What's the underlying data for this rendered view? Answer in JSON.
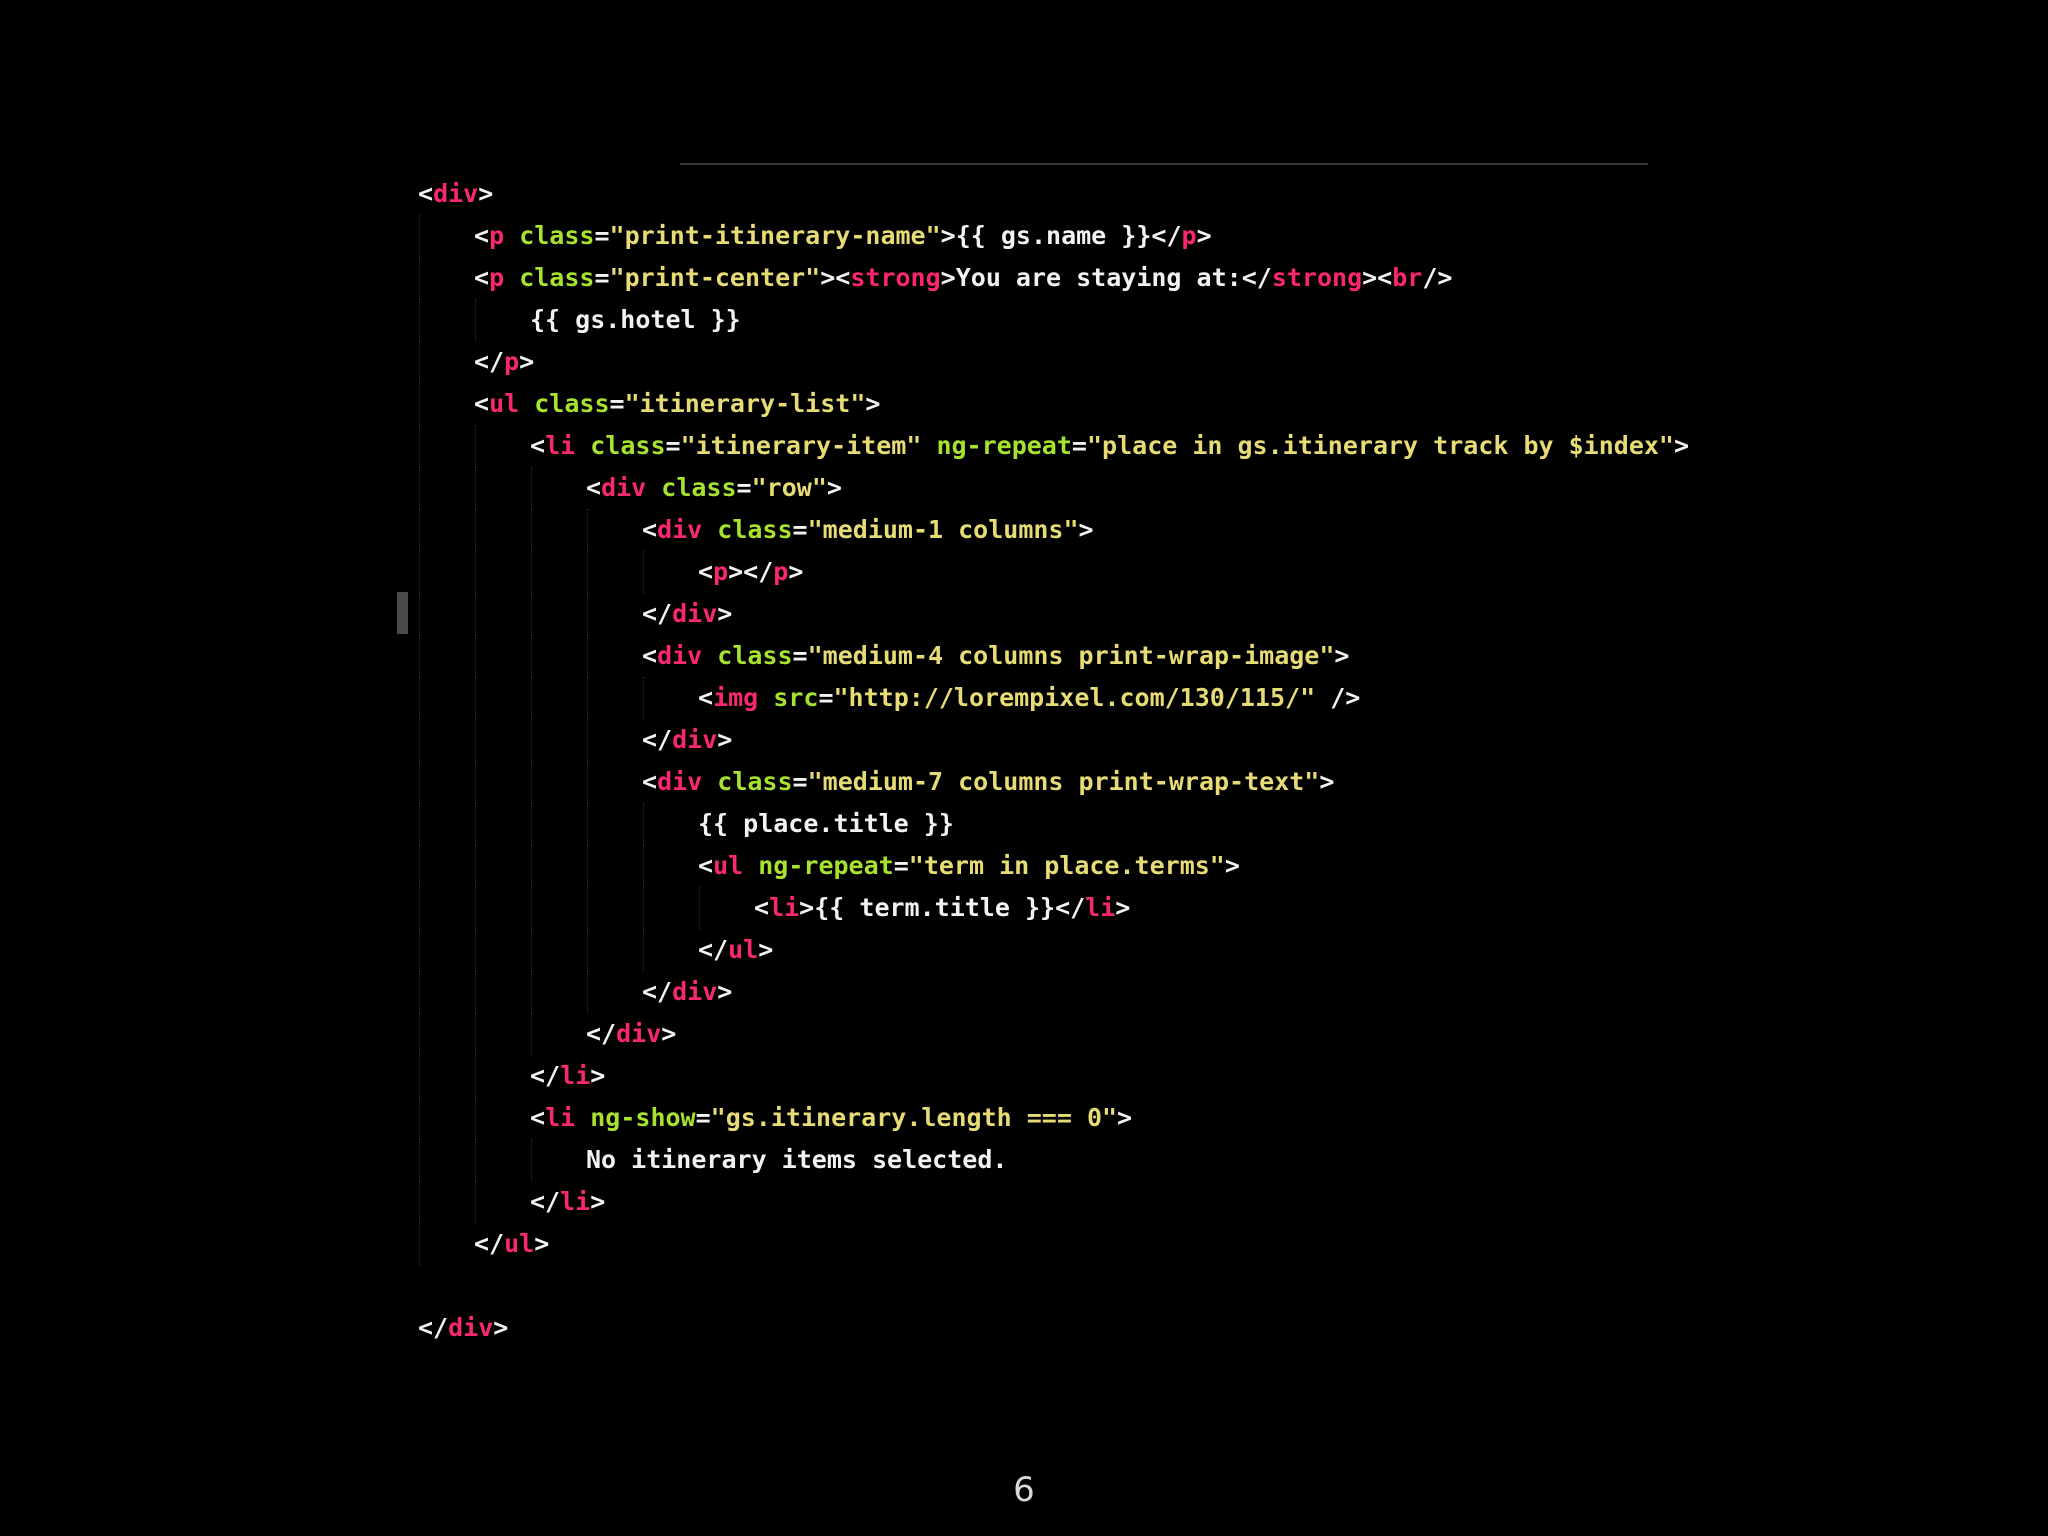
{
  "page_number": "6",
  "colors": {
    "background": "#000000",
    "tag": "#f92672",
    "attribute": "#a6e22e",
    "string": "#e6db74",
    "text": "#f2f2f2"
  },
  "code_lines": [
    {
      "indent": 0,
      "tokens": [
        {
          "t": "punct",
          "v": "<"
        },
        {
          "t": "tag",
          "v": "div"
        },
        {
          "t": "punct",
          "v": ">"
        }
      ]
    },
    {
      "indent": 1,
      "tokens": [
        {
          "t": "punct",
          "v": "<"
        },
        {
          "t": "tag",
          "v": "p"
        },
        {
          "t": "text",
          "v": " "
        },
        {
          "t": "attr",
          "v": "class"
        },
        {
          "t": "punct",
          "v": "="
        },
        {
          "t": "str",
          "v": "\"print-itinerary-name\""
        },
        {
          "t": "punct",
          "v": ">"
        },
        {
          "t": "text",
          "v": "{{ gs.name }}"
        },
        {
          "t": "punct",
          "v": "</"
        },
        {
          "t": "tag",
          "v": "p"
        },
        {
          "t": "punct",
          "v": ">"
        }
      ]
    },
    {
      "indent": 1,
      "tokens": [
        {
          "t": "punct",
          "v": "<"
        },
        {
          "t": "tag",
          "v": "p"
        },
        {
          "t": "text",
          "v": " "
        },
        {
          "t": "attr",
          "v": "class"
        },
        {
          "t": "punct",
          "v": "="
        },
        {
          "t": "str",
          "v": "\"print-center\""
        },
        {
          "t": "punct",
          "v": "><"
        },
        {
          "t": "tag",
          "v": "strong"
        },
        {
          "t": "punct",
          "v": ">"
        },
        {
          "t": "text",
          "v": "You are staying at:"
        },
        {
          "t": "punct",
          "v": "</"
        },
        {
          "t": "tag",
          "v": "strong"
        },
        {
          "t": "punct",
          "v": "><"
        },
        {
          "t": "tag",
          "v": "br"
        },
        {
          "t": "punct",
          "v": "/>"
        }
      ]
    },
    {
      "indent": 2,
      "tokens": [
        {
          "t": "text",
          "v": "{{ gs.hotel }}"
        }
      ]
    },
    {
      "indent": 1,
      "tokens": [
        {
          "t": "punct",
          "v": "</"
        },
        {
          "t": "tag",
          "v": "p"
        },
        {
          "t": "punct",
          "v": ">"
        }
      ]
    },
    {
      "indent": 1,
      "tokens": [
        {
          "t": "punct",
          "v": "<"
        },
        {
          "t": "tag",
          "v": "ul"
        },
        {
          "t": "text",
          "v": " "
        },
        {
          "t": "attr",
          "v": "class"
        },
        {
          "t": "punct",
          "v": "="
        },
        {
          "t": "str",
          "v": "\"itinerary-list\""
        },
        {
          "t": "punct",
          "v": ">"
        }
      ]
    },
    {
      "indent": 2,
      "tokens": [
        {
          "t": "punct",
          "v": "<"
        },
        {
          "t": "tag",
          "v": "li"
        },
        {
          "t": "text",
          "v": " "
        },
        {
          "t": "attr",
          "v": "class"
        },
        {
          "t": "punct",
          "v": "="
        },
        {
          "t": "str",
          "v": "\"itinerary-item\""
        },
        {
          "t": "text",
          "v": " "
        },
        {
          "t": "attr",
          "v": "ng-repeat"
        },
        {
          "t": "punct",
          "v": "="
        },
        {
          "t": "str",
          "v": "\"place in gs.itinerary track by $index\""
        },
        {
          "t": "punct",
          "v": ">"
        }
      ]
    },
    {
      "indent": 3,
      "tokens": [
        {
          "t": "punct",
          "v": "<"
        },
        {
          "t": "tag",
          "v": "div"
        },
        {
          "t": "text",
          "v": " "
        },
        {
          "t": "attr",
          "v": "class"
        },
        {
          "t": "punct",
          "v": "="
        },
        {
          "t": "str",
          "v": "\"row\""
        },
        {
          "t": "punct",
          "v": ">"
        }
      ]
    },
    {
      "indent": 4,
      "tokens": [
        {
          "t": "punct",
          "v": "<"
        },
        {
          "t": "tag",
          "v": "div"
        },
        {
          "t": "text",
          "v": " "
        },
        {
          "t": "attr",
          "v": "class"
        },
        {
          "t": "punct",
          "v": "="
        },
        {
          "t": "str",
          "v": "\"medium-1 columns\""
        },
        {
          "t": "punct",
          "v": ">"
        }
      ]
    },
    {
      "indent": 5,
      "tokens": [
        {
          "t": "punct",
          "v": "<"
        },
        {
          "t": "tag",
          "v": "p"
        },
        {
          "t": "punct",
          "v": "></"
        },
        {
          "t": "tag",
          "v": "p"
        },
        {
          "t": "punct",
          "v": ">"
        }
      ]
    },
    {
      "indent": 4,
      "tokens": [
        {
          "t": "punct",
          "v": "</"
        },
        {
          "t": "tag",
          "v": "div"
        },
        {
          "t": "punct",
          "v": ">"
        }
      ]
    },
    {
      "indent": 4,
      "tokens": [
        {
          "t": "punct",
          "v": "<"
        },
        {
          "t": "tag",
          "v": "div"
        },
        {
          "t": "text",
          "v": " "
        },
        {
          "t": "attr",
          "v": "class"
        },
        {
          "t": "punct",
          "v": "="
        },
        {
          "t": "str",
          "v": "\"medium-4 columns print-wrap-image\""
        },
        {
          "t": "punct",
          "v": ">"
        }
      ]
    },
    {
      "indent": 5,
      "tokens": [
        {
          "t": "punct",
          "v": "<"
        },
        {
          "t": "tag",
          "v": "img"
        },
        {
          "t": "text",
          "v": " "
        },
        {
          "t": "attr",
          "v": "src"
        },
        {
          "t": "punct",
          "v": "="
        },
        {
          "t": "str",
          "v": "\"http://lorempixel.com/130/115/\""
        },
        {
          "t": "text",
          "v": " "
        },
        {
          "t": "punct",
          "v": "/>"
        }
      ]
    },
    {
      "indent": 4,
      "tokens": [
        {
          "t": "punct",
          "v": "</"
        },
        {
          "t": "tag",
          "v": "div"
        },
        {
          "t": "punct",
          "v": ">"
        }
      ]
    },
    {
      "indent": 4,
      "tokens": [
        {
          "t": "punct",
          "v": "<"
        },
        {
          "t": "tag",
          "v": "div"
        },
        {
          "t": "text",
          "v": " "
        },
        {
          "t": "attr",
          "v": "class"
        },
        {
          "t": "punct",
          "v": "="
        },
        {
          "t": "str",
          "v": "\"medium-7 columns print-wrap-text\""
        },
        {
          "t": "punct",
          "v": ">"
        }
      ]
    },
    {
      "indent": 5,
      "tokens": [
        {
          "t": "text",
          "v": "{{ place.title }}"
        }
      ]
    },
    {
      "indent": 5,
      "tokens": [
        {
          "t": "punct",
          "v": "<"
        },
        {
          "t": "tag",
          "v": "ul"
        },
        {
          "t": "text",
          "v": " "
        },
        {
          "t": "attr",
          "v": "ng-repeat"
        },
        {
          "t": "punct",
          "v": "="
        },
        {
          "t": "str",
          "v": "\"term in place.terms\""
        },
        {
          "t": "punct",
          "v": ">"
        }
      ]
    },
    {
      "indent": 6,
      "tokens": [
        {
          "t": "punct",
          "v": "<"
        },
        {
          "t": "tag",
          "v": "li"
        },
        {
          "t": "punct",
          "v": ">"
        },
        {
          "t": "text",
          "v": "{{ term.title }}"
        },
        {
          "t": "punct",
          "v": "</"
        },
        {
          "t": "tag",
          "v": "li"
        },
        {
          "t": "punct",
          "v": ">"
        }
      ]
    },
    {
      "indent": 5,
      "tokens": [
        {
          "t": "punct",
          "v": "</"
        },
        {
          "t": "tag",
          "v": "ul"
        },
        {
          "t": "punct",
          "v": ">"
        }
      ]
    },
    {
      "indent": 4,
      "tokens": [
        {
          "t": "punct",
          "v": "</"
        },
        {
          "t": "tag",
          "v": "div"
        },
        {
          "t": "punct",
          "v": ">"
        }
      ]
    },
    {
      "indent": 3,
      "tokens": [
        {
          "t": "punct",
          "v": "</"
        },
        {
          "t": "tag",
          "v": "div"
        },
        {
          "t": "punct",
          "v": ">"
        }
      ]
    },
    {
      "indent": 2,
      "tokens": [
        {
          "t": "punct",
          "v": "</"
        },
        {
          "t": "tag",
          "v": "li"
        },
        {
          "t": "punct",
          "v": ">"
        }
      ]
    },
    {
      "indent": 2,
      "tokens": [
        {
          "t": "punct",
          "v": "<"
        },
        {
          "t": "tag",
          "v": "li"
        },
        {
          "t": "text",
          "v": " "
        },
        {
          "t": "attr",
          "v": "ng-show"
        },
        {
          "t": "punct",
          "v": "="
        },
        {
          "t": "str",
          "v": "\"gs.itinerary.length === 0\""
        },
        {
          "t": "punct",
          "v": ">"
        }
      ]
    },
    {
      "indent": 3,
      "tokens": [
        {
          "t": "text",
          "v": "No itinerary items selected."
        }
      ]
    },
    {
      "indent": 2,
      "tokens": [
        {
          "t": "punct",
          "v": "</"
        },
        {
          "t": "tag",
          "v": "li"
        },
        {
          "t": "punct",
          "v": ">"
        }
      ]
    },
    {
      "indent": 1,
      "tokens": [
        {
          "t": "punct",
          "v": "</"
        },
        {
          "t": "tag",
          "v": "ul"
        },
        {
          "t": "punct",
          "v": ">"
        }
      ]
    },
    {
      "indent": 0,
      "tokens": []
    },
    {
      "indent": 0,
      "tokens": [
        {
          "t": "punct",
          "v": "</"
        },
        {
          "t": "tag",
          "v": "div"
        },
        {
          "t": "punct",
          "v": ">"
        }
      ]
    }
  ]
}
